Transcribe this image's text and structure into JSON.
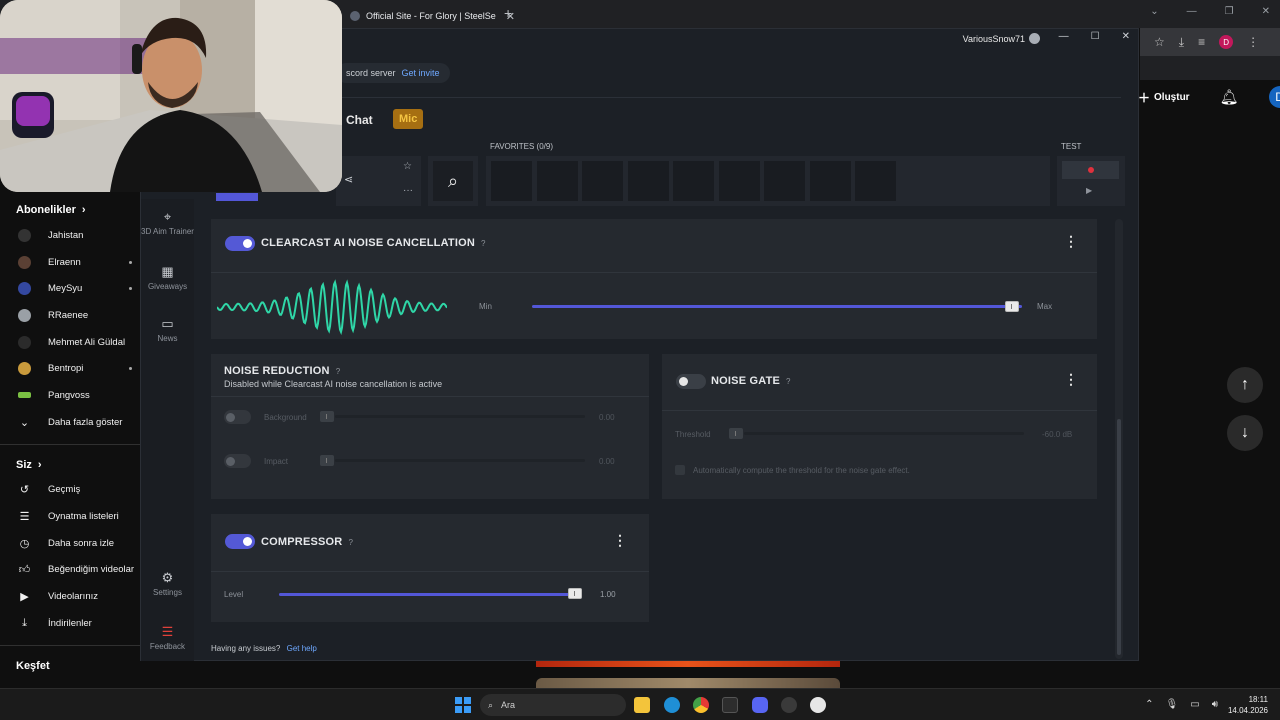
{
  "browser": {
    "tab_title": "Official Site - For Glory | SteelSe",
    "new_tab_icon": "plus-icon"
  },
  "youtube": {
    "create_label": "Oluştur",
    "avatar_letter": "D",
    "subscriptions_title": "Abonelikler",
    "channels": [
      {
        "name": "Jahistan",
        "new": false
      },
      {
        "name": "Elraenn",
        "new": true
      },
      {
        "name": "MeySyu",
        "new": true
      },
      {
        "name": "RRaenee",
        "new": false
      },
      {
        "name": "Mehmet Ali Güldal",
        "new": false
      },
      {
        "name": "Bentropi",
        "new": true
      },
      {
        "name": "Pangvoss",
        "new": false
      }
    ],
    "show_more": "Daha fazla göster",
    "you_title": "Siz",
    "you_items": [
      {
        "label": "Geçmiş",
        "icon": "history-icon"
      },
      {
        "label": "Oynatma listeleri",
        "icon": "playlist-icon"
      },
      {
        "label": "Daha sonra izle",
        "icon": "clock-icon"
      },
      {
        "label": "Beğendiğim videolar",
        "icon": "thumbs-up-icon"
      },
      {
        "label": "Videolarınız",
        "icon": "video-icon"
      },
      {
        "label": "İndirilenler",
        "icon": "download-icon"
      }
    ],
    "explore_title": "Keşfet"
  },
  "gg": {
    "username": "VariousSnow71",
    "discord_text": "scord server",
    "discord_link": "Get invite",
    "tab_chat": "Chat",
    "tab_mic": "Mic",
    "favorites_label": "FAVORITES (0/9)",
    "test_label": "TEST",
    "nav": [
      {
        "label": "3D Aim Trainer",
        "icon": "crosshair-icon"
      },
      {
        "label": "Giveaways",
        "icon": "gift-icon"
      },
      {
        "label": "News",
        "icon": "news-icon"
      },
      {
        "label": "Settings",
        "icon": "gear-icon"
      },
      {
        "label": "Feedback",
        "icon": "feedback-icon"
      }
    ],
    "clearcast": {
      "title": "CLEARCAST AI NOISE CANCELLATION",
      "help": "?",
      "enabled": true,
      "min_label": "Min",
      "max_label": "Max",
      "level": 0.98
    },
    "noise_reduction": {
      "title": "NOISE REDUCTION",
      "help": "?",
      "subtitle": "Disabled while Clearcast AI noise cancellation is active",
      "rows": [
        {
          "label": "Background",
          "value": "0.00"
        },
        {
          "label": "Impact",
          "value": "0.00"
        }
      ]
    },
    "noise_gate": {
      "title": "NOISE GATE",
      "help": "?",
      "enabled": false,
      "threshold_label": "Threshold",
      "threshold_value": "-60.0 dB",
      "auto_label": "Automatically compute the threshold for the noise gate effect."
    },
    "compressor": {
      "title": "COMPRESSOR",
      "help": "?",
      "enabled": true,
      "level_label": "Level",
      "level_value": "1.00",
      "level": 1.0
    },
    "help_text": "Having any issues?",
    "help_link": "Get help"
  },
  "taskbar": {
    "search_placeholder": "Ara",
    "time": "18:11",
    "date": "14.04.2026"
  },
  "colors": {
    "accent": "#5357d8",
    "wave": "#2fd6a7",
    "mic_tab_bg": "#a66f12",
    "mic_tab_text": "#f5c542",
    "record": "#e0313d"
  }
}
